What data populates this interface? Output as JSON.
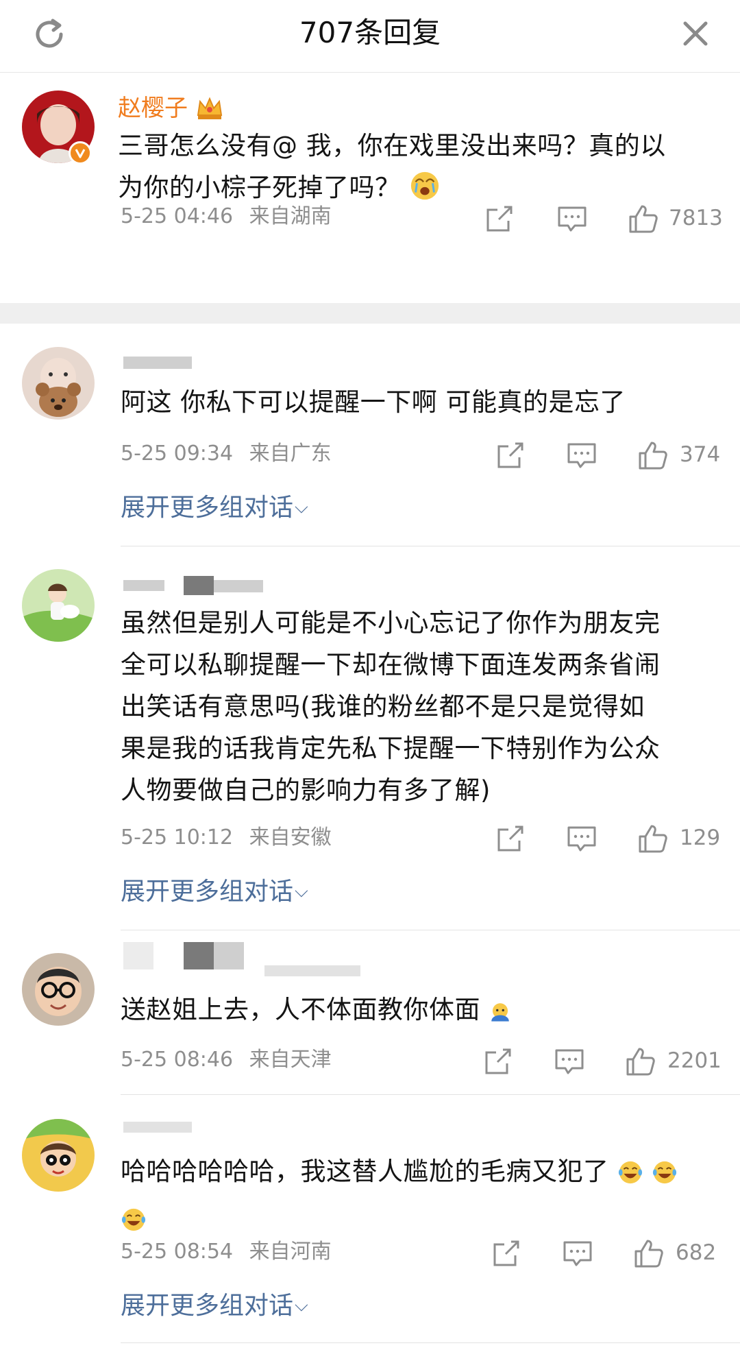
{
  "header": {
    "title": "707条回复",
    "refresh_icon": "refresh-icon",
    "close_icon": "close-icon"
  },
  "featured": {
    "username": "赵樱子",
    "badge_icon": "crown-icon",
    "verified_icon": "verified-v-icon",
    "text_line1": "三哥怎么没有@ 我，你在戏里没出来吗？真的以",
    "text_line2": "为你的小棕子死掉了吗？",
    "emoji": "crying-face-emoji",
    "time": "5-25 04:46",
    "location": "来自湖南",
    "likes": "7813"
  },
  "replies": [
    {
      "text_lines": [
        "阿这 你私下可以提醒一下啊 可能真的是忘了"
      ],
      "time": "5-25 09:34",
      "location": "来自广东",
      "likes": "374",
      "more_label": "展开更多组对话"
    },
    {
      "text_lines": [
        "虽然但是别人可能是不小心忘记了你作为朋友完",
        "全可以私聊提醒一下却在微博下面连发两条省闹",
        "出笑话有意思吗(我谁的粉丝都不是只是觉得如",
        "果是我的话我肯定先私下提醒一下特别作为公众",
        "人物要做自己的影响力有多了解)"
      ],
      "time": "5-25 10:12",
      "location": "来自安徽",
      "likes": "129",
      "more_label": "展开更多组对话"
    },
    {
      "text_lines": [
        "送赵姐上去，人不体面教你体面"
      ],
      "time": "5-25 08:46",
      "location": "来自天津",
      "likes": "2201"
    },
    {
      "text_lines": [
        "哈哈哈哈哈哈，我这替人尴尬的毛病又犯了"
      ],
      "time": "5-25 08:54",
      "location": "来自河南",
      "likes": "682",
      "more_label": "展开更多组对话"
    }
  ],
  "icons": {
    "share": "share-icon",
    "comment": "comment-icon",
    "like": "thumbs-up-icon"
  },
  "colors": {
    "vip_name": "#f07c1e",
    "link": "#4d6e9a",
    "meta": "#8e8e8e",
    "separator": "#efefef"
  }
}
